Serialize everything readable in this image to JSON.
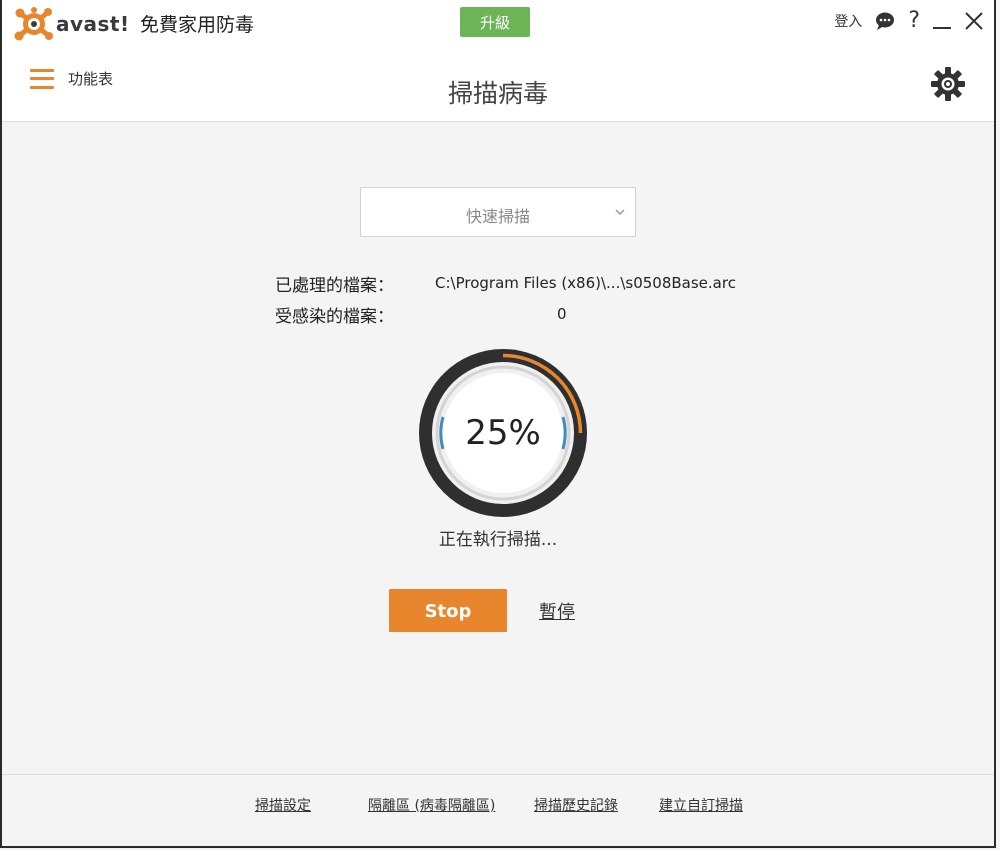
{
  "titlebar": {
    "logo_text": "avast!",
    "product_name": "免費家用防毒",
    "upgrade_label": "升級",
    "login_label": "登入",
    "colors": {
      "upgrade": "#6cb557",
      "brand_orange": "#e8862e"
    }
  },
  "header": {
    "menu_label": "功能表",
    "title": "掃描病毒"
  },
  "scan": {
    "type_selected": "快速掃描",
    "processed_label": "已處理的檔案：",
    "processed_value": "C:\\Program Files (x86)\\...\\s0508Base.arc",
    "infected_label": "受感染的檔案：",
    "infected_value": "0",
    "progress_percent": 25,
    "progress_text": "25%",
    "status": "正在執行掃描...",
    "stop_label": "Stop",
    "pause_label": "暫停"
  },
  "footer": {
    "links": [
      {
        "label": "掃描設定"
      },
      {
        "label": "隔離區 (病毒隔離區)"
      },
      {
        "label": "掃描歷史記錄"
      },
      {
        "label": "建立自訂掃描"
      }
    ]
  },
  "icons": {
    "logo": "avast-logo-icon",
    "chat": "chat-icon",
    "help": "help-icon",
    "minimize": "minimize-icon",
    "close": "close-icon",
    "menu": "hamburger-icon",
    "settings": "gear-icon",
    "dropdown": "chevron-down-icon"
  }
}
